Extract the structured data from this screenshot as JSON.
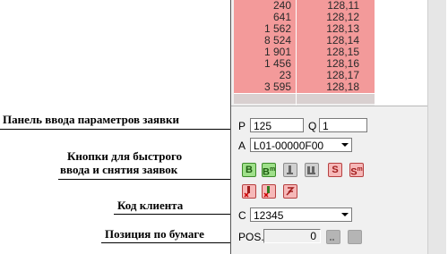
{
  "annotations": {
    "order_params": "Панель ввода параметров заявки",
    "quick_buttons_line1": "Кнопки для быстрого",
    "quick_buttons_line2": "ввода и снятия заявок",
    "client_code": "Код клиента",
    "position": "Позиция по бумаге"
  },
  "orderbook": {
    "rows": [
      {
        "qty": "240",
        "price": "128,11"
      },
      {
        "qty": "641",
        "price": "128,12"
      },
      {
        "qty": "1 562",
        "price": "128,13"
      },
      {
        "qty": "8 524",
        "price": "128,14"
      },
      {
        "qty": "1 901",
        "price": "128,15"
      },
      {
        "qty": "1 456",
        "price": "128,16"
      },
      {
        "qty": "23",
        "price": "128,17"
      },
      {
        "qty": "3 595",
        "price": "128,18"
      }
    ]
  },
  "form": {
    "price_label": "P",
    "price_value": "125",
    "qty_label": "Q",
    "qty_value": "1",
    "account_label": "A",
    "account_value": "L01-00000F00",
    "client_label": "C",
    "client_value": "12345",
    "pos_label": "POS.",
    "pos_value": "0"
  },
  "buttons": {
    "buy": "B",
    "buy_market": "B",
    "sell": "S",
    "sell_market": "S",
    "market_sup": "m"
  },
  "colors": {
    "ask_bg": "#f39a9a",
    "selected_bg": "#d9d0d0",
    "buy_green": "#9fe08a",
    "sell_red": "#f6b8b8"
  }
}
